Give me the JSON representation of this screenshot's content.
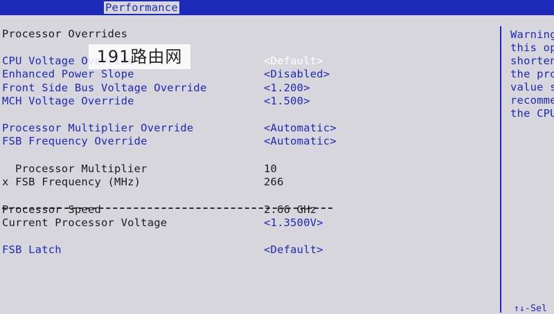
{
  "header": {
    "tab_label": "Performance"
  },
  "main": {
    "section_title": "Processor Overrides",
    "settings": [
      {
        "label": "CPU Voltage Override",
        "value": "<Default>"
      },
      {
        "label": "Enhanced Power Slope",
        "value": "<Disabled>"
      },
      {
        "label": "Front Side Bus Voltage Override",
        "value": "<1.200>"
      },
      {
        "label": "MCH Voltage Override",
        "value": "<1.500>"
      },
      {
        "label": "Processor Multiplier Override",
        "value": "<Automatic>"
      },
      {
        "label": "FSB Frequency Override",
        "value": "<Automatic>"
      }
    ],
    "info": [
      {
        "label": "Processor Multiplier",
        "value": "10"
      },
      {
        "label": "x FSB Frequency (MHz)",
        "value": "266"
      },
      {
        "label": "Processor Speed",
        "value": "2.66 GHz"
      }
    ],
    "voltage": {
      "label": "Current Processor Voltage",
      "value": "<1.3500V>"
    },
    "fsb_latch": {
      "label": "FSB Latch",
      "value": "<Default>"
    }
  },
  "help": {
    "lines": [
      "Warning",
      "this op",
      "shorten",
      "the pro",
      "value s",
      "recomme",
      "the CPU"
    ],
    "footer": "↑↓-Sel"
  },
  "watermark": {
    "text": "191路由网"
  },
  "colors": {
    "blue": "#1d29b8",
    "background": "#d6d6dc",
    "selected_text": "#ffffff",
    "text_dark": "#1b1b1b"
  }
}
